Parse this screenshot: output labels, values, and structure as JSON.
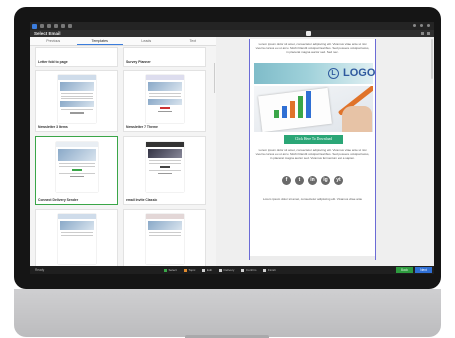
{
  "window": {
    "title": "Select Email"
  },
  "tabs": [
    "Previous",
    "Templates",
    "Leads",
    "Text"
  ],
  "templates": [
    {
      "caption": "Letter fold to page"
    },
    {
      "caption": "Survey Planner"
    },
    {
      "caption": "Newsletter 3 Items"
    },
    {
      "caption": "Newsletter 7 Theme"
    },
    {
      "caption": "Connect Delivery Sender"
    },
    {
      "caption": "email Invite Classic"
    }
  ],
  "preview": {
    "intro": "Lorem ipsum dolor sit amet, consectetur adipiscing elit. Vivamus vitae ante ut nisi viverra cursus eu ut arcu. Morbi blandit volutpat faucibus. Sed posuere volutpat lacus, in placerat magna auctor sed. Sed nec.",
    "logo_mark": "L",
    "logo_text": "LOGO",
    "cta_label": "Click Here To Download",
    "body": "Lorem ipsum dolor sit amet, consectetur adipiscing elit. Vivamus vitae ante ut nisi viverra cursus eu ut arcu. Morbi blandit volutpat faucibus. Sed posuere volutpat lacus, in placerat magna auctor sed. Vivamus fermentum est a sapien.",
    "socials": [
      "f",
      "t",
      "in",
      "ig",
      "yt"
    ],
    "footer": "Lorem ipsum dolor sit amet, consectetur adipiscing elit. Vivamus vitae ante"
  },
  "bottombar": {
    "status": "Ready",
    "legend": [
      {
        "label": "Select",
        "color": "#3aa648"
      },
      {
        "label": "Topic",
        "color": "#e08a2e"
      },
      {
        "label": "Edit",
        "color": "#d0d0d0"
      },
      {
        "label": "Delivery",
        "color": "#d0d0d0"
      },
      {
        "label": "Confirm",
        "color": "#d0d0d0"
      },
      {
        "label": "Finish",
        "color": "#d0d0d0"
      }
    ],
    "back_label": "Back",
    "next_label": "Next"
  },
  "colors": {
    "accent": "#2f6fd4",
    "success": "#3aa648",
    "cta": "#2aa676"
  }
}
